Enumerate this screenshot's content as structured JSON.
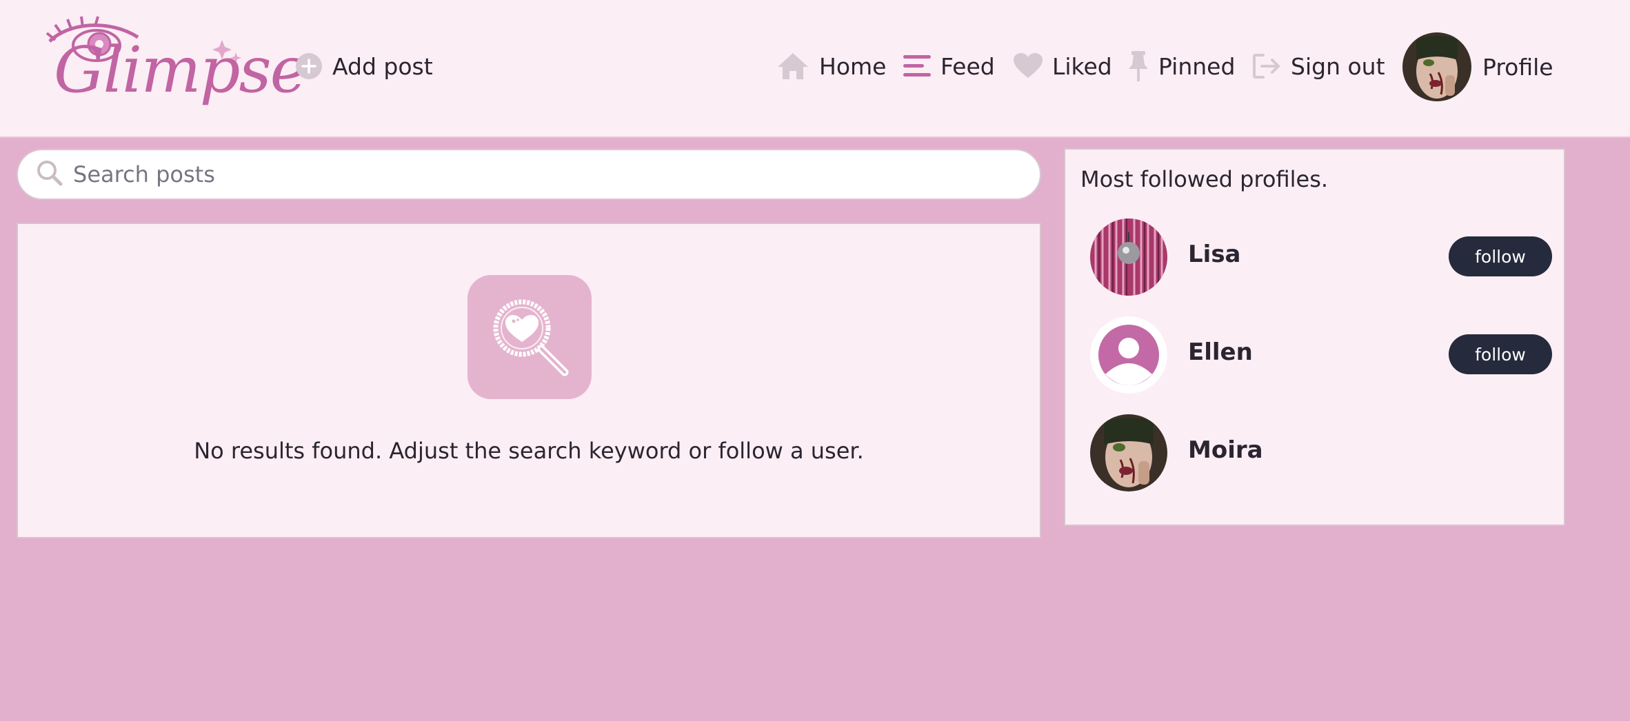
{
  "header": {
    "logo_text": "Glimpse",
    "add_post_label": "Add post",
    "nav": {
      "home": "Home",
      "feed": "Feed",
      "liked": "Liked",
      "pinned": "Pinned",
      "sign_out": "Sign out",
      "profile": "Profile"
    }
  },
  "search": {
    "placeholder": "Search posts",
    "value": ""
  },
  "results": {
    "empty_message": "No results found. Adjust the search keyword or follow a user."
  },
  "sidebar": {
    "title": "Most followed profiles.",
    "profiles": [
      {
        "name": "Lisa",
        "follow_label": "follow",
        "avatar": "disco-ball-photo"
      },
      {
        "name": "Ellen",
        "follow_label": "follow",
        "avatar": "default-user-icon"
      },
      {
        "name": "Moira",
        "avatar": "portrait-photo"
      }
    ]
  },
  "colors": {
    "page_background": "#e2b0cd",
    "header_background": "#fbeef4",
    "brand": "#c164a3",
    "button_dark": "#252a3d",
    "icon_muted": "#d6c9d1"
  }
}
